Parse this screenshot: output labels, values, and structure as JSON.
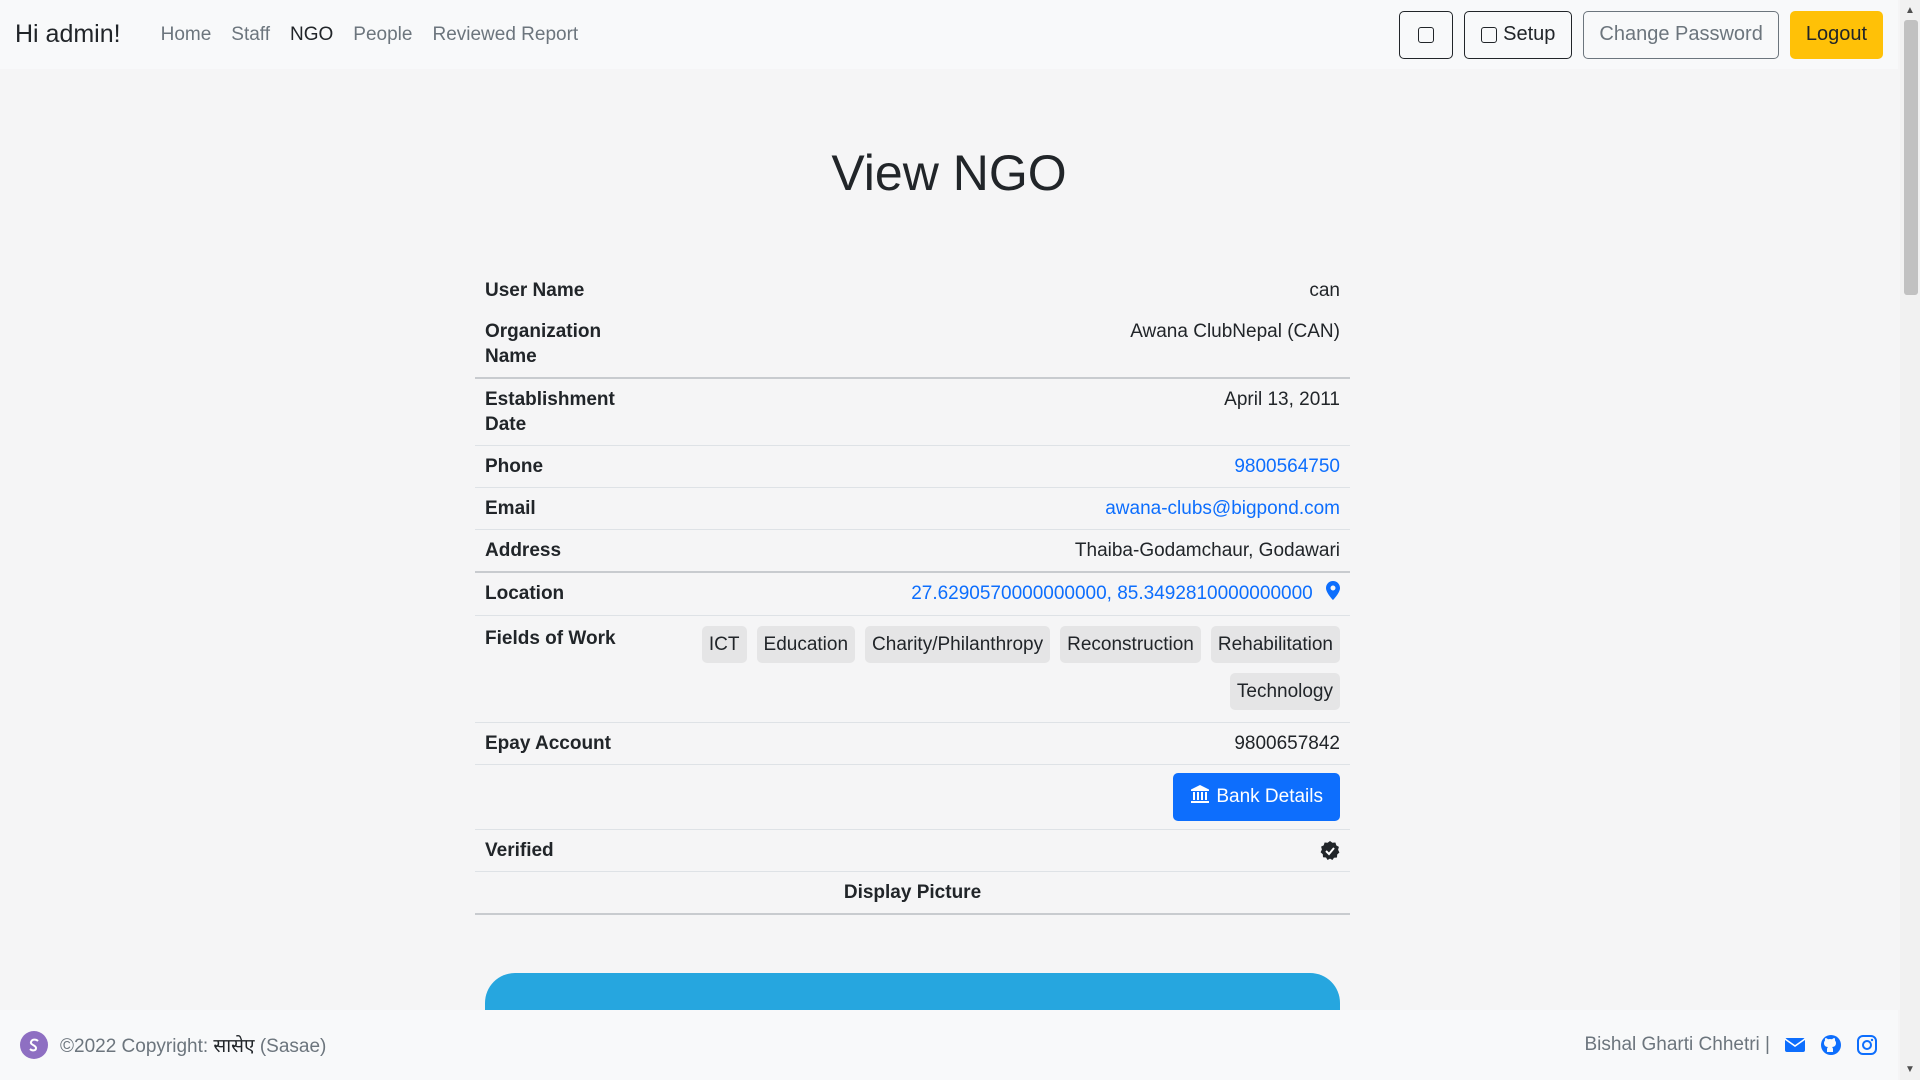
{
  "navbar": {
    "brand": "Hi admin!",
    "links": [
      {
        "label": "Home"
      },
      {
        "label": "Staff"
      },
      {
        "label": "NGO"
      },
      {
        "label": "People"
      },
      {
        "label": "Reviewed Report"
      }
    ],
    "setup_label": "Setup",
    "change_password_label": "Change Password",
    "logout_label": "Logout"
  },
  "main": {
    "title": "View NGO",
    "rows": {
      "username": {
        "label": "User Name",
        "value": "can"
      },
      "org": {
        "label": "Organization Name",
        "value": "Awana ClubNepal (CAN)"
      },
      "est": {
        "label": "Establishment Date",
        "value": "April 13, 2011"
      },
      "phone": {
        "label": "Phone",
        "value": "9800564750"
      },
      "email": {
        "label": "Email",
        "value": "awana-clubs@bigpond.com"
      },
      "address": {
        "label": "Address",
        "value": "Thaiba-Godamchaur, Godawari"
      },
      "location": {
        "label": "Location",
        "value": "27.6290570000000000, 85.3492810000000000"
      },
      "fields": {
        "label": "Fields of Work",
        "badges": [
          "ICT",
          "Education",
          "Charity/Philanthropy",
          "Reconstruction",
          "Rehabilitation",
          "Technology"
        ]
      },
      "epay": {
        "label": "Epay Account",
        "value": "9800657842"
      },
      "bank_button": "Bank Details",
      "verified": {
        "label": "Verified"
      },
      "display_picture": "Display Picture"
    }
  },
  "footer": {
    "copyright_prefix": "©2022 Copyright: ",
    "brand_native": "सासेए",
    "brand_latin": " (Sasae)",
    "author": "Bishal Gharti Chhetri |"
  },
  "colors": {
    "accent": "#0d6efd",
    "warning": "#ffc107",
    "image_blue": "#26a6df"
  }
}
